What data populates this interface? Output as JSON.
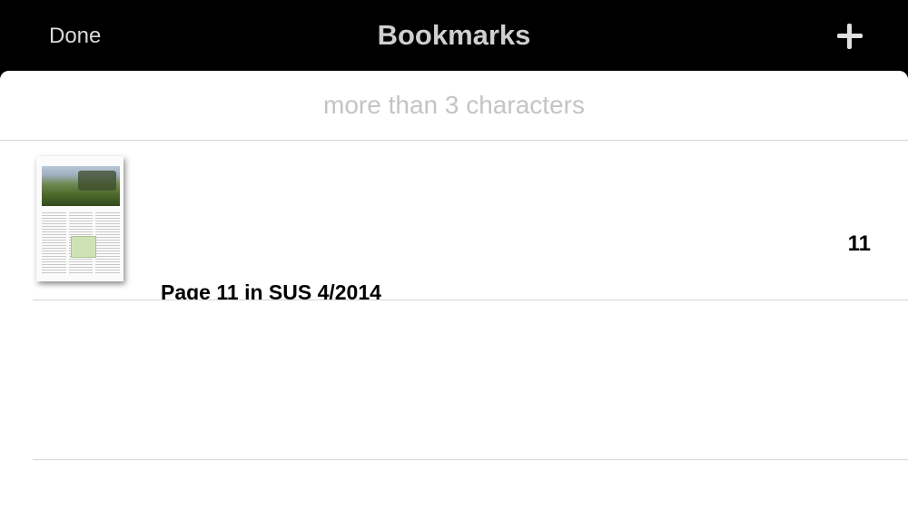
{
  "navbar": {
    "done_label": "Done",
    "title": "Bookmarks",
    "add_icon": "plus-icon"
  },
  "search": {
    "placeholder": "more than 3 characters",
    "value": ""
  },
  "bookmarks": [
    {
      "title": "Page 11 in SUS 4/2014",
      "page_number": "11",
      "thumbnail": "magazine-page-thumbnail"
    }
  ],
  "colors": {
    "navbar_background": "#000000",
    "navbar_text": "#cfcfcf",
    "sheet_background": "#ffffff",
    "placeholder_text": "#c4c4c4",
    "separator": "#d6d6d6"
  }
}
